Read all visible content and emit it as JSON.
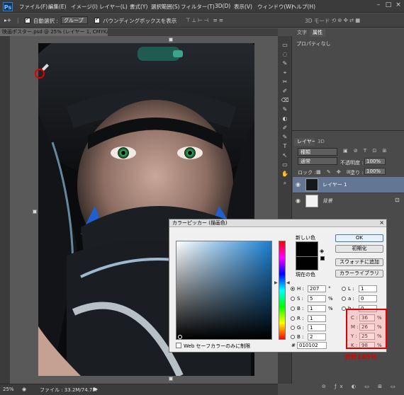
{
  "app": {
    "logo": "Ps"
  },
  "menu": {
    "items": [
      "ファイル(F)",
      "編集(E)",
      "イメージ(I)",
      "レイヤー(L)",
      "書式(Y)",
      "選択範囲(S)",
      "フィルター(T)",
      "3D(D)",
      "表示(V)",
      "ウィンドウ(W)",
      "ヘルプ(H)"
    ]
  },
  "options": {
    "auto_select_label": "自動選択 :",
    "auto_select_value": "グループ",
    "bbox_label": "バウンディングボックスを表示",
    "mode_3d": "3D モード :"
  },
  "document": {
    "tab_title": "映画ポスター.psd @ 25% (レイヤー 1, CMYK/8) *",
    "tab_close": "×"
  },
  "statusbar": {
    "zoom": "25%",
    "file_info": "ファイル : 33.2M/74.7M"
  },
  "panels": {
    "info_tabs": [
      "文字",
      "属性"
    ],
    "info_text": "プロパティなし",
    "layers_tabs": [
      "レイヤー",
      "3D"
    ],
    "kind_label": "種類",
    "blend_mode": "通常",
    "opacity_label": "不透明度 :",
    "opacity_value": "100%",
    "lock_label": "ロック :",
    "fill_label": "塗り :",
    "fill_value": "100%",
    "layers": [
      {
        "name": "レイヤー 1"
      },
      {
        "name": "背景"
      }
    ]
  },
  "picker": {
    "title": "カラーピッカー (描画色)",
    "close": "×",
    "new_label": "新しい色",
    "current_label": "現在の色",
    "ok": "OK",
    "reset": "初期化",
    "add_swatch": "スウォッチに追加",
    "libraries": "カラーライブラリ",
    "web_safe": "Web セーフカラーのみに制限",
    "hex_label": "#",
    "hex": "010102",
    "h_label": "H :",
    "h": "207",
    "h_unit": "°",
    "s_label": "S :",
    "s": "5",
    "s_unit": "%",
    "b_label": "B :",
    "b": "1",
    "b_unit": "%",
    "r_label": "R :",
    "r": "1",
    "g_label": "G :",
    "g": "1",
    "bb_label": "B :",
    "bb": "2",
    "l_label": "L :",
    "l": "1",
    "a_label": "a :",
    "a": "0",
    "lab_b_label": "b :",
    "lab_b": "0",
    "c_label": "C :",
    "c": "36",
    "m_label": "M :",
    "m": "26",
    "y_label": "Y :",
    "y": "25",
    "k_label": "K :",
    "k": "98",
    "pct": "%",
    "total": "合計185％"
  },
  "colors": {
    "highlight": "#e00000",
    "picked": "#010102"
  }
}
